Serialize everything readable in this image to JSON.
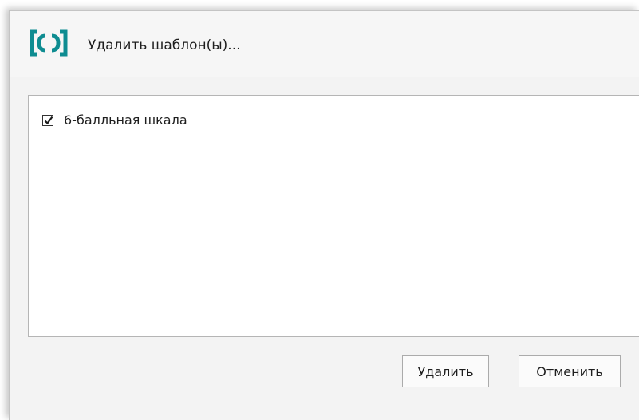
{
  "dialog": {
    "title": "Удалить шаблон(ы)...",
    "icon": "app-logo-brackets-icon",
    "accent_color": "#0e8c91"
  },
  "list": {
    "items": [
      {
        "label": "6-балльная шкала",
        "checked": true
      }
    ]
  },
  "buttons": {
    "delete_label": "Удалить",
    "cancel_label": "Отменить"
  }
}
